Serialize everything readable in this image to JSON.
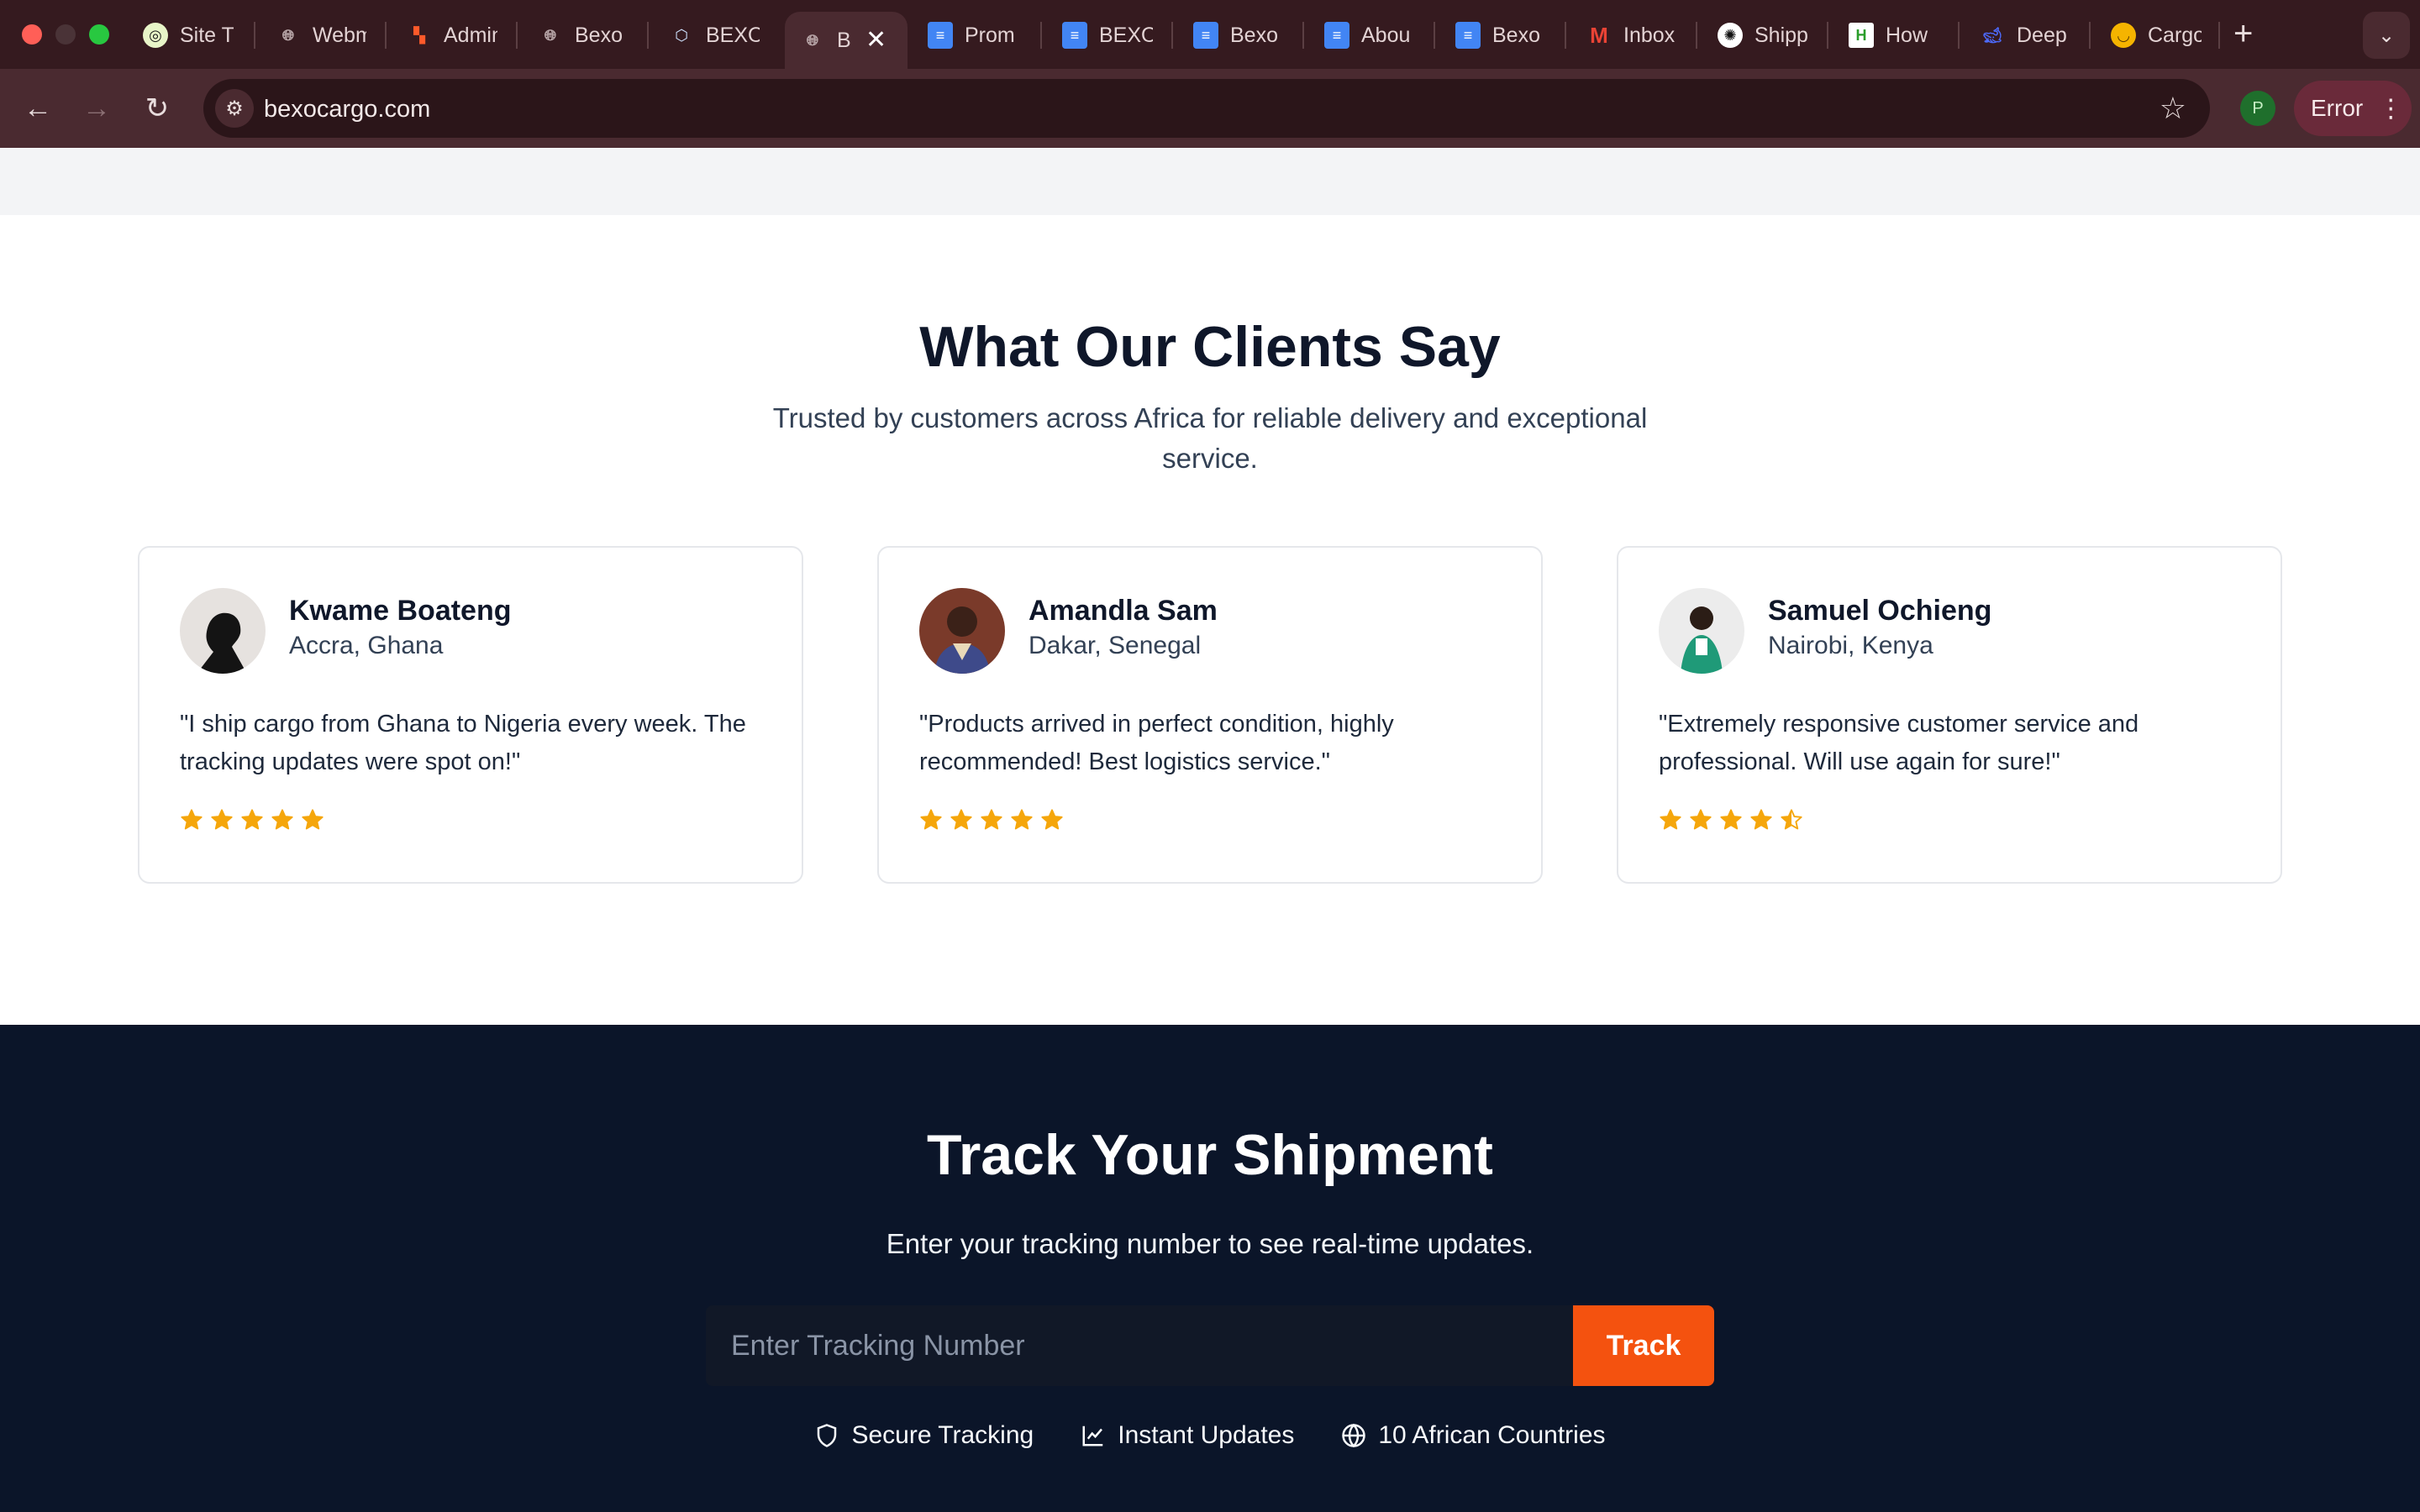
{
  "browser": {
    "tabs": [
      {
        "title": "Site T",
        "icon": "site-icon"
      },
      {
        "title": "Webm",
        "icon": "globe-icon"
      },
      {
        "title": "Admin",
        "icon": "admin-icon"
      },
      {
        "title": "Bexo",
        "icon": "globe-icon"
      },
      {
        "title": "BEXO",
        "icon": "box-icon"
      },
      {
        "title": "B",
        "icon": "globe-icon",
        "active": true
      },
      {
        "title": "Prom",
        "icon": "docs-icon"
      },
      {
        "title": "BEXO",
        "icon": "docs-icon"
      },
      {
        "title": "Bexo",
        "icon": "docs-icon"
      },
      {
        "title": "Abou",
        "icon": "docs-icon"
      },
      {
        "title": "Bexo",
        "icon": "docs-icon"
      },
      {
        "title": "Inbox",
        "icon": "gmail-icon"
      },
      {
        "title": "Shipp",
        "icon": "openai-icon"
      },
      {
        "title": "How",
        "icon": "h-icon"
      },
      {
        "title": "Deep",
        "icon": "deepseek-icon"
      },
      {
        "title": "Cargo",
        "icon": "smile-icon"
      }
    ],
    "url": "bexocargo.com",
    "profile_initial": "P",
    "error_label": "Error"
  },
  "testimonials": {
    "title": "What Our Clients Say",
    "subtitle": "Trusted by customers across Africa for reliable delivery and exceptional service.",
    "cards": [
      {
        "name": "Kwame Boateng",
        "location": "Accra, Ghana",
        "quote": "\"I ship cargo from Ghana to Nigeria every week. The tracking updates were spot on!\"",
        "rating": 5
      },
      {
        "name": "Amandla Sam",
        "location": "Dakar, Senegal",
        "quote": "\"Products arrived in perfect condition, highly recommended! Best logistics service.\"",
        "rating": 5
      },
      {
        "name": "Samuel Ochieng",
        "location": "Nairobi, Kenya",
        "quote": "\"Extremely responsive customer service and professional. Will use again for sure!\"",
        "rating": 4.5
      }
    ]
  },
  "tracking": {
    "title": "Track Your Shipment",
    "subtitle": "Enter your tracking number to see real-time updates.",
    "placeholder": "Enter Tracking Number",
    "button_label": "Track",
    "features": [
      {
        "label": "Secure Tracking",
        "icon": "shield-icon"
      },
      {
        "label": "Instant Updates",
        "icon": "chart-icon"
      },
      {
        "label": "10 African Countries",
        "icon": "globe-icon"
      }
    ]
  },
  "colors": {
    "accent": "#f4520f",
    "star": "#f5a60b",
    "dark_bg": "#0b1529"
  }
}
